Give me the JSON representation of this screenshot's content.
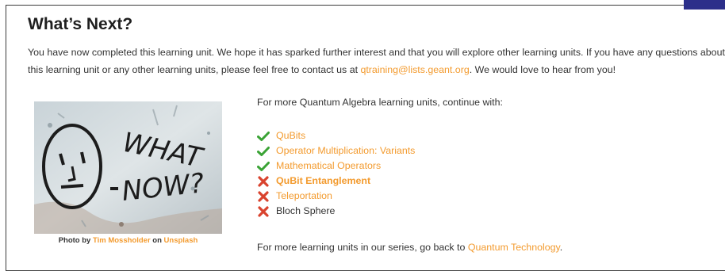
{
  "heading": "What’s Next?",
  "intro": {
    "text_before": "You have now completed this learning unit. We hope it has sparked further interest and that you will explore other learning units. If you have any questions about this learning unit or any other learning units, please feel free to contact us at ",
    "email": "qtraining@lists.geant.org",
    "text_after": ". We would love to hear from you!"
  },
  "photo": {
    "graffiti_word1": "WHAT",
    "graffiti_word2": "NOW?",
    "caption_prefix": "Photo by ",
    "author": "Tim Mossholder",
    "caption_mid": " on ",
    "source": "Unsplash"
  },
  "continue_text": "For more Quantum Algebra learning units, continue with:",
  "units": [
    {
      "label": "QuBits",
      "status": "check",
      "style": "orange"
    },
    {
      "label": "Operator Multiplication: Variants",
      "status": "check",
      "style": "orange"
    },
    {
      "label": "Mathematical Operators",
      "status": "check",
      "style": "orange"
    },
    {
      "label": "QuBit Entanglement",
      "status": "cross",
      "style": "bold"
    },
    {
      "label": "Teleportation",
      "status": "cross",
      "style": "orange"
    },
    {
      "label": "Bloch Sphere",
      "status": "cross",
      "style": "plain"
    }
  ],
  "back": {
    "text_before": "For more learning units in our series, go back to ",
    "link": "Quantum Technology",
    "text_after": "."
  },
  "colors": {
    "link": "#f39b2f",
    "check": "#3aa335",
    "cross": "#d9432e"
  }
}
